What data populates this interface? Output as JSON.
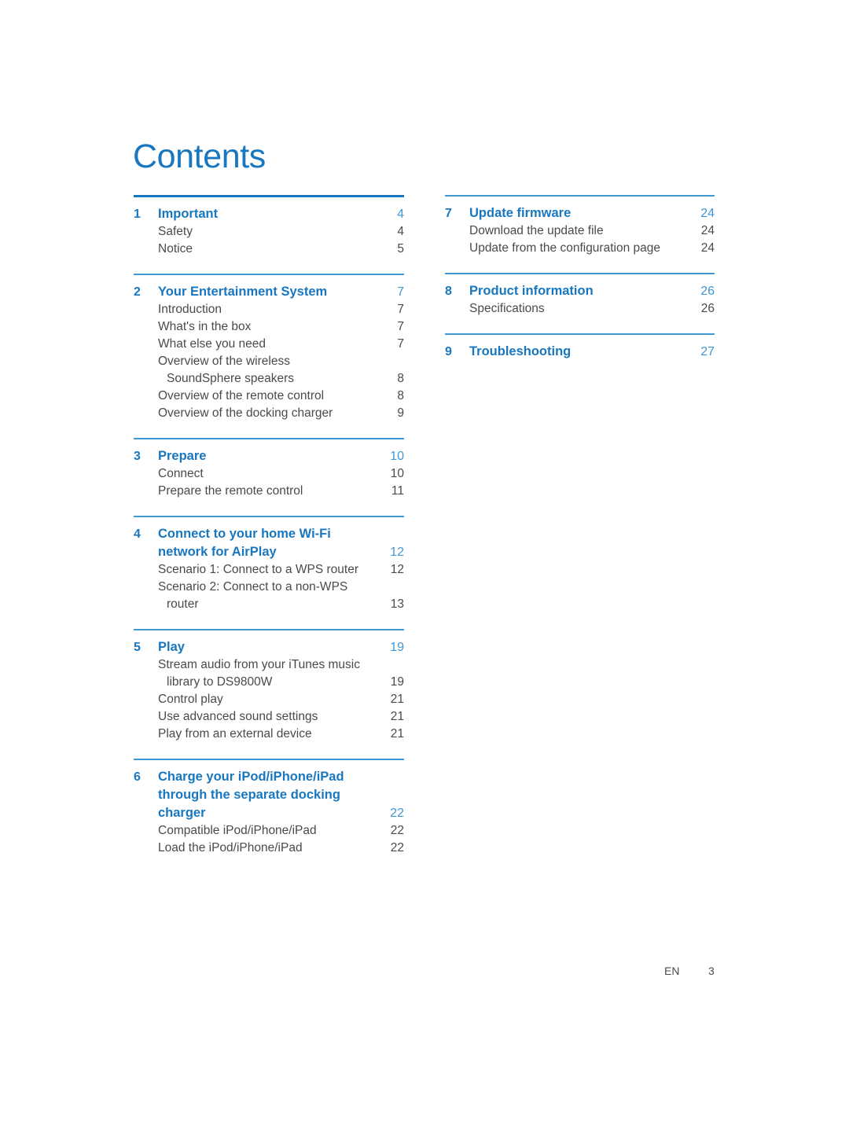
{
  "document": {
    "title": "Contents"
  },
  "footer": {
    "language": "EN",
    "page_number": "3"
  },
  "colors": {
    "heading_blue": "#1877be",
    "rule_blue": "#3f97d3",
    "body_gray": "#4a4a4a"
  },
  "toc": {
    "left_column": [
      {
        "number": "1",
        "title": "Important",
        "page": "4",
        "rule": "thick",
        "entries": [
          {
            "label": "Safety",
            "page": "4"
          },
          {
            "label": "Notice",
            "page": "5"
          }
        ]
      },
      {
        "number": "2",
        "title": "Your Entertainment System",
        "page": "7",
        "rule": "thin",
        "entries": [
          {
            "label": "Introduction",
            "page": "7"
          },
          {
            "label": "What's in the box",
            "page": "7"
          },
          {
            "label": "What else you need",
            "page": "7"
          },
          {
            "label": "Overview of the wireless",
            "page": ""
          },
          {
            "label": "SoundSphere speakers",
            "page": "8",
            "continuation": true
          },
          {
            "label": "Overview of the remote control",
            "page": "8"
          },
          {
            "label": "Overview of the docking charger",
            "page": "9"
          }
        ]
      },
      {
        "number": "3",
        "title": "Prepare",
        "page": "10",
        "rule": "thin",
        "entries": [
          {
            "label": "Connect",
            "page": "10"
          },
          {
            "label": "Prepare the remote control",
            "page": "11"
          }
        ]
      },
      {
        "number": "4",
        "title": "Connect to your home Wi-Fi",
        "title_line2": "network for AirPlay",
        "page": "12",
        "rule": "thin",
        "entries": [
          {
            "label": "Scenario 1: Connect to a WPS router",
            "page": "12"
          },
          {
            "label": "Scenario 2: Connect to a non-WPS",
            "page": ""
          },
          {
            "label": "router",
            "page": "13",
            "continuation": true
          }
        ]
      },
      {
        "number": "5",
        "title": "Play",
        "page": "19",
        "rule": "thin",
        "entries": [
          {
            "label": "Stream audio from your iTunes music",
            "page": ""
          },
          {
            "label": "library to DS9800W",
            "page": "19",
            "continuation": true
          },
          {
            "label": "Control play",
            "page": "21"
          },
          {
            "label": "Use advanced sound settings",
            "page": "21"
          },
          {
            "label": "Play from an external device",
            "page": "21"
          }
        ]
      },
      {
        "number": "6",
        "title": "Charge your iPod/iPhone/iPad",
        "title_line2": "through the separate docking",
        "title_line3": "charger",
        "page": "22",
        "rule": "thin",
        "entries": [
          {
            "label": "Compatible iPod/iPhone/iPad",
            "page": "22"
          },
          {
            "label": "Load the iPod/iPhone/iPad",
            "page": "22"
          }
        ]
      }
    ],
    "right_column": [
      {
        "number": "7",
        "title": "Update firmware",
        "page": "24",
        "rule": "thin",
        "entries": [
          {
            "label": "Download the update file",
            "page": "24"
          },
          {
            "label": "Update from the configuration page",
            "page": "24"
          }
        ]
      },
      {
        "number": "8",
        "title": "Product information",
        "page": "26",
        "rule": "thin",
        "entries": [
          {
            "label": "Specifications",
            "page": "26"
          }
        ]
      },
      {
        "number": "9",
        "title": "Troubleshooting",
        "page": "27",
        "rule": "thin",
        "entries": []
      }
    ]
  }
}
